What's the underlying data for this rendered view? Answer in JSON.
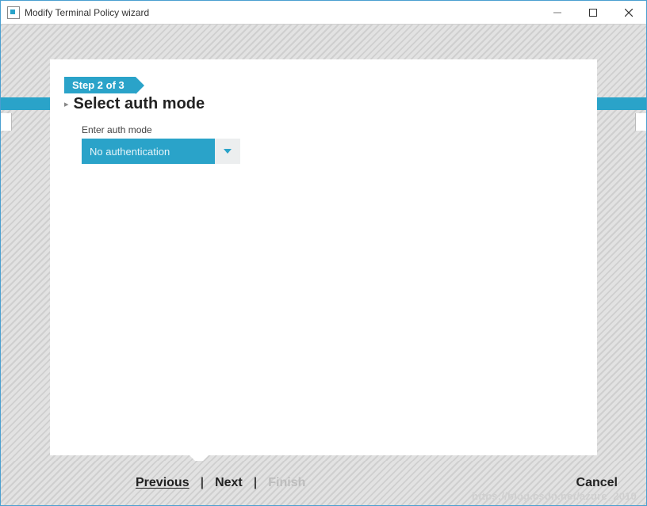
{
  "window": {
    "title": "Modify Terminal Policy wizard"
  },
  "wizard": {
    "step_badge": "Step 2 of 3",
    "section_title": "Select auth mode",
    "field_label": "Enter auth mode",
    "dropdown_value": "No authentication"
  },
  "nav": {
    "previous": "Previous",
    "next": "Next",
    "finish": "Finish",
    "cancel": "Cancel"
  },
  "watermark": "https://blog.csdn.net/azure_2010"
}
